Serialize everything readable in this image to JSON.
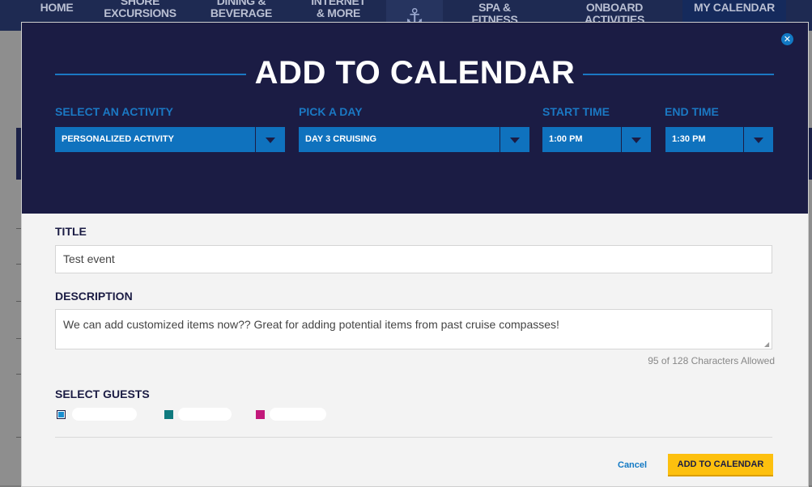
{
  "nav": {
    "items": [
      {
        "label": "Home"
      },
      {
        "label": "Shore Excursions"
      },
      {
        "label": "Dining & Beverage"
      },
      {
        "label": "Internet & More"
      },
      {
        "label": "Spa & Fitness"
      },
      {
        "label": "Onboard Activities"
      },
      {
        "label": "My Calendar"
      }
    ]
  },
  "modal": {
    "title": "ADD TO CALENDAR",
    "close_icon": "close-icon",
    "selects": {
      "activity": {
        "label": "SELECT AN ACTIVITY",
        "value": "PERSONALIZED ACTIVITY"
      },
      "day": {
        "label": "PICK A DAY",
        "value": "DAY 3 CRUISING"
      },
      "start": {
        "label": "START TIME",
        "value": "1:00 PM"
      },
      "end": {
        "label": "END TIME",
        "value": "1:30 PM"
      }
    },
    "title_field": {
      "label": "TITLE",
      "value": "Test event"
    },
    "description_field": {
      "label": "DESCRIPTION",
      "value": "We can add customized items now?? Great for adding potential items from past cruise compasses!"
    },
    "char_count": "95 of 128 Characters Allowed",
    "guests": {
      "label": "SELECT GUESTS",
      "colors": [
        "#1a8fd0",
        "#0f7a7e",
        "#c2187a"
      ]
    },
    "cancel_label": "Cancel",
    "submit_label": "ADD TO CALENDAR"
  },
  "colors": {
    "header_bg": "#1b1c44",
    "accent_blue": "#1279c4",
    "button_yellow": "#fdc00e"
  }
}
